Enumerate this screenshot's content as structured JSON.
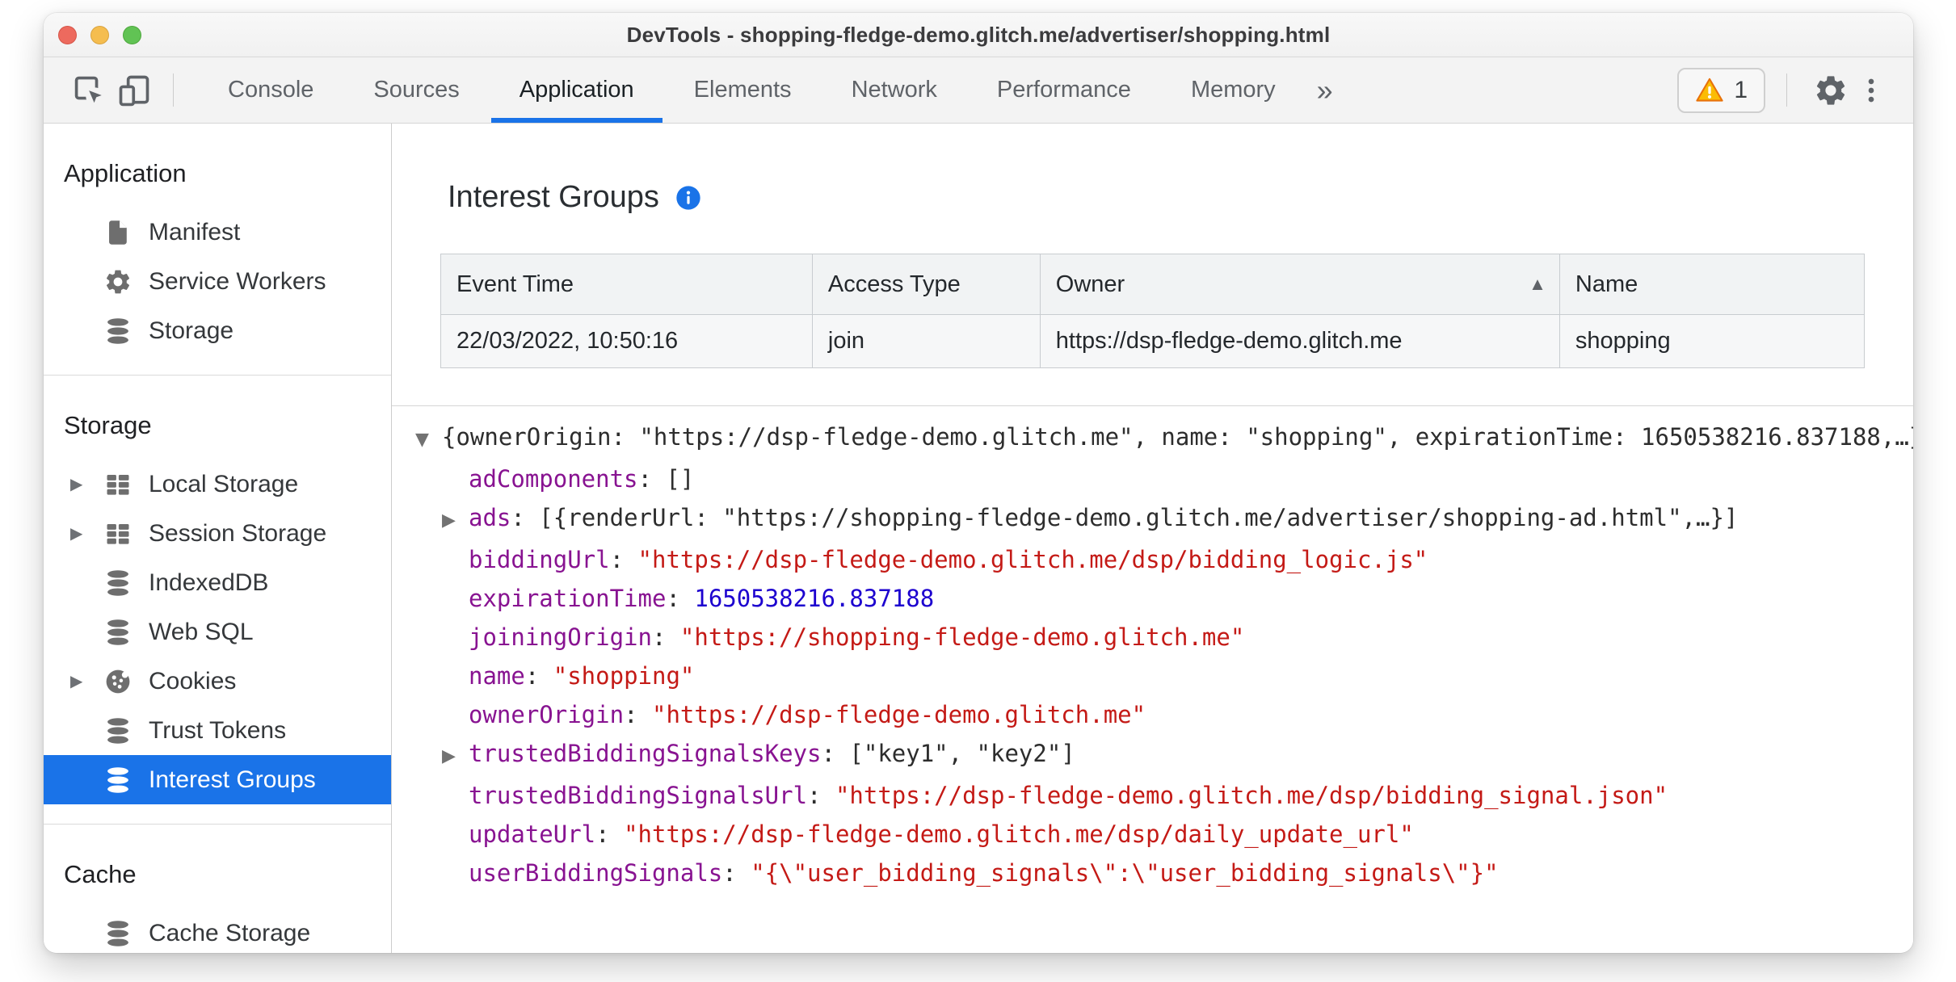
{
  "window": {
    "title": "DevTools - shopping-fledge-demo.glitch.me/advertiser/shopping.html"
  },
  "toolbar": {
    "tabs": [
      {
        "label": "Console",
        "selected": false
      },
      {
        "label": "Sources",
        "selected": false
      },
      {
        "label": "Application",
        "selected": true
      },
      {
        "label": "Elements",
        "selected": false
      },
      {
        "label": "Network",
        "selected": false
      },
      {
        "label": "Performance",
        "selected": false
      },
      {
        "label": "Memory",
        "selected": false
      }
    ],
    "more_tabs_label": "»",
    "warning_count": "1"
  },
  "sidebar": {
    "sections": [
      {
        "title": "Application",
        "items": [
          {
            "label": "Manifest",
            "icon": "file-icon"
          },
          {
            "label": "Service Workers",
            "icon": "gear-icon"
          },
          {
            "label": "Storage",
            "icon": "database-icon"
          }
        ]
      },
      {
        "title": "Storage",
        "items": [
          {
            "label": "Local Storage",
            "icon": "table-icon",
            "caret": true
          },
          {
            "label": "Session Storage",
            "icon": "table-icon",
            "caret": true
          },
          {
            "label": "IndexedDB",
            "icon": "database-icon"
          },
          {
            "label": "Web SQL",
            "icon": "database-icon"
          },
          {
            "label": "Cookies",
            "icon": "cookie-icon",
            "caret": true
          },
          {
            "label": "Trust Tokens",
            "icon": "database-icon"
          },
          {
            "label": "Interest Groups",
            "icon": "database-icon",
            "selected": true
          }
        ]
      },
      {
        "title": "Cache",
        "items": [
          {
            "label": "Cache Storage",
            "icon": "database-icon"
          }
        ]
      }
    ]
  },
  "content": {
    "title": "Interest Groups",
    "table": {
      "columns": [
        "Event Time",
        "Access Type",
        "Owner",
        "Name"
      ],
      "sorted_column": "Owner",
      "sort_direction": "asc",
      "rows": [
        [
          "22/03/2022, 10:50:16",
          "join",
          "https://dsp-fledge-demo.glitch.me",
          "shopping"
        ]
      ]
    },
    "json_tree": {
      "lines": [
        {
          "indent": 0,
          "caret": "expanded",
          "segments": [
            {
              "type": "plain",
              "text": "{ownerOrigin: \"https://dsp-fledge-demo.glitch.me\", name: \"shopping\", expirationTime: 1650538216.837188,…}"
            }
          ]
        },
        {
          "indent": 1,
          "caret": null,
          "segments": [
            {
              "type": "key",
              "text": "adComponents"
            },
            {
              "type": "plain",
              "text": ": []"
            }
          ]
        },
        {
          "indent": 1,
          "caret": "collapsed",
          "segments": [
            {
              "type": "key",
              "text": "ads"
            },
            {
              "type": "plain",
              "text": ": [{renderUrl: \"https://shopping-fledge-demo.glitch.me/advertiser/shopping-ad.html\",…}]"
            }
          ]
        },
        {
          "indent": 1,
          "caret": null,
          "segments": [
            {
              "type": "key",
              "text": "biddingUrl"
            },
            {
              "type": "plain",
              "text": ": "
            },
            {
              "type": "string",
              "text": "\"https://dsp-fledge-demo.glitch.me/dsp/bidding_logic.js\""
            }
          ]
        },
        {
          "indent": 1,
          "caret": null,
          "segments": [
            {
              "type": "key",
              "text": "expirationTime"
            },
            {
              "type": "plain",
              "text": ": "
            },
            {
              "type": "number",
              "text": "1650538216.837188"
            }
          ]
        },
        {
          "indent": 1,
          "caret": null,
          "segments": [
            {
              "type": "key",
              "text": "joiningOrigin"
            },
            {
              "type": "plain",
              "text": ": "
            },
            {
              "type": "string",
              "text": "\"https://shopping-fledge-demo.glitch.me\""
            }
          ]
        },
        {
          "indent": 1,
          "caret": null,
          "segments": [
            {
              "type": "key",
              "text": "name"
            },
            {
              "type": "plain",
              "text": ": "
            },
            {
              "type": "string",
              "text": "\"shopping\""
            }
          ]
        },
        {
          "indent": 1,
          "caret": null,
          "segments": [
            {
              "type": "key",
              "text": "ownerOrigin"
            },
            {
              "type": "plain",
              "text": ": "
            },
            {
              "type": "string",
              "text": "\"https://dsp-fledge-demo.glitch.me\""
            }
          ]
        },
        {
          "indent": 1,
          "caret": "collapsed",
          "segments": [
            {
              "type": "key",
              "text": "trustedBiddingSignalsKeys"
            },
            {
              "type": "plain",
              "text": ": [\"key1\", \"key2\"]"
            }
          ]
        },
        {
          "indent": 1,
          "caret": null,
          "segments": [
            {
              "type": "key",
              "text": "trustedBiddingSignalsUrl"
            },
            {
              "type": "plain",
              "text": ": "
            },
            {
              "type": "string",
              "text": "\"https://dsp-fledge-demo.glitch.me/dsp/bidding_signal.json\""
            }
          ]
        },
        {
          "indent": 1,
          "caret": null,
          "segments": [
            {
              "type": "key",
              "text": "updateUrl"
            },
            {
              "type": "plain",
              "text": ": "
            },
            {
              "type": "string",
              "text": "\"https://dsp-fledge-demo.glitch.me/dsp/daily_update_url\""
            }
          ]
        },
        {
          "indent": 1,
          "caret": null,
          "segments": [
            {
              "type": "key",
              "text": "userBiddingSignals"
            },
            {
              "type": "plain",
              "text": ": "
            },
            {
              "type": "string",
              "text": "\"{\\\"user_bidding_signals\\\":\\\"user_bidding_signals\\\"}\""
            }
          ]
        }
      ]
    }
  },
  "colors": {
    "accent": "#1a73e8",
    "selected_item_bg": "#1a73e8",
    "json_key": "#881391",
    "json_string": "#c41a16",
    "json_number": "#1c00cf",
    "warning_yellow": "#fbbc04"
  }
}
